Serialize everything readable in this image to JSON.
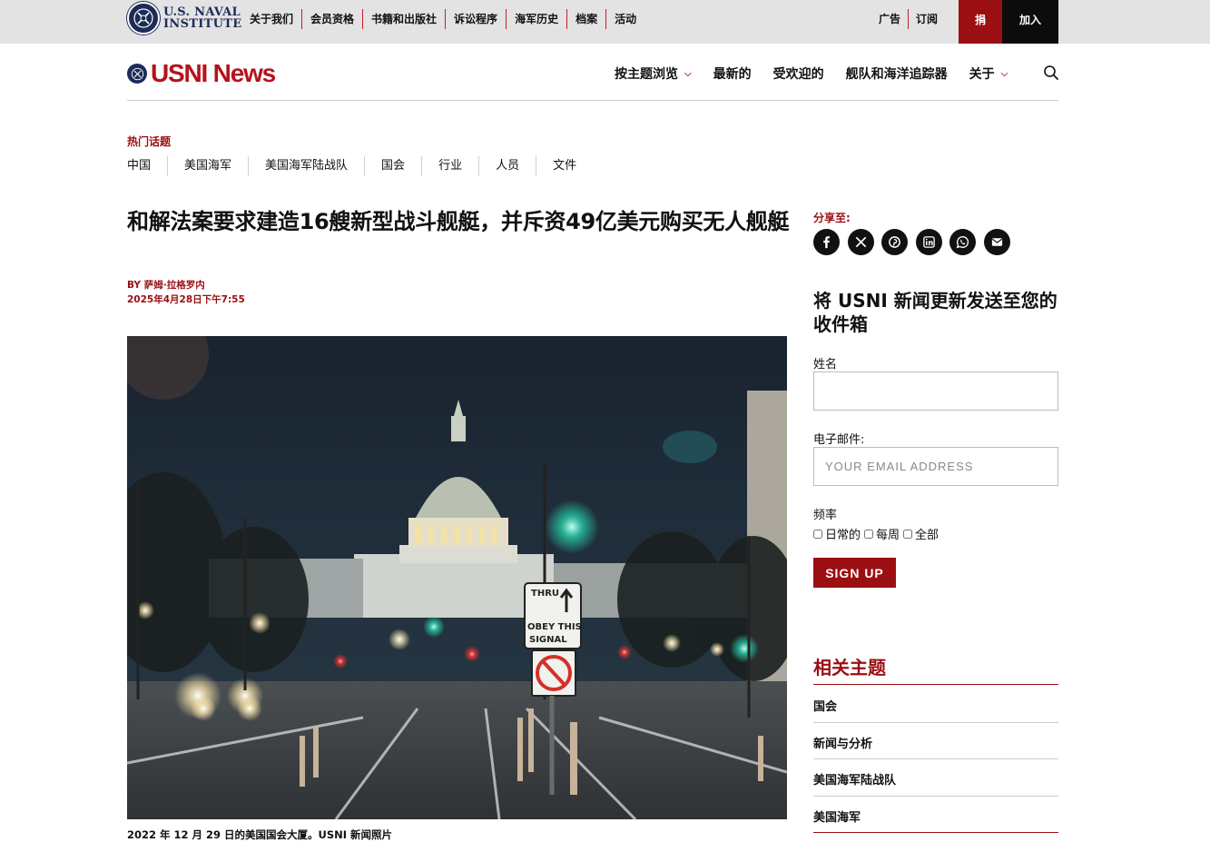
{
  "topbar": {
    "logo_line1": "U.S. NAVAL",
    "logo_line2": "INSTITUTE",
    "nav": [
      "关于我们",
      "会员资格",
      "书籍和出版社",
      "诉讼程序",
      "海军历史",
      "档案",
      "活动"
    ],
    "links": [
      "广告",
      "订阅"
    ],
    "donate_label": "捐",
    "join_label": "加入"
  },
  "header": {
    "wordmark": "USNI News",
    "nav": [
      {
        "label": "按主题浏览",
        "has_dropdown": true
      },
      {
        "label": "最新的",
        "has_dropdown": false
      },
      {
        "label": "受欢迎的",
        "has_dropdown": false
      },
      {
        "label": "舰队和海洋追踪器",
        "has_dropdown": false
      },
      {
        "label": "关于",
        "has_dropdown": true
      }
    ],
    "search_icon": "search-icon"
  },
  "trending": {
    "label": "热门话题",
    "topics": [
      "中国",
      "美国海军",
      "美国海军陆战队",
      "国会",
      "行业",
      "人员",
      "文件"
    ]
  },
  "article": {
    "headline": "和解法案要求建造16艘新型战斗舰艇，并斥资49亿美元购买无人舰艇",
    "byline_prefix": "BY",
    "author": "萨姆·拉格罗内",
    "date": "2025年4月28日下午7:55",
    "caption": "2022 年 12 月 29 日的美国国会大厦。USNI 新闻照片",
    "sign_text": {
      "thru": "THRU",
      "obey": "OBEY THIS",
      "signal": "SIGNAL"
    }
  },
  "sidebar": {
    "share_label": "分享至:",
    "share_icons": [
      "facebook-icon",
      "x-icon",
      "pinterest-icon",
      "linkedin-icon",
      "whatsapp-icon",
      "email-icon"
    ],
    "newsletter_title": "将 USNI 新闻更新发送至您的收件箱",
    "name_label": "姓名",
    "name_value": "",
    "email_label": "电子邮件:",
    "email_placeholder": "YOUR EMAIL ADDRESS",
    "frequency_label": "频率",
    "frequency_options": [
      "日常的",
      "每周",
      "全部"
    ],
    "signup_label": "SIGN UP",
    "related_title": "相关主题",
    "related_topics": [
      "国会",
      "新闻与分析",
      "美国海军陆战队",
      "美国海军"
    ]
  },
  "colors": {
    "brand_red": "#9b0f12",
    "logo_red": "#b5121b",
    "navy": "#1d2b57",
    "topbar_gray": "#e3e3e3"
  }
}
